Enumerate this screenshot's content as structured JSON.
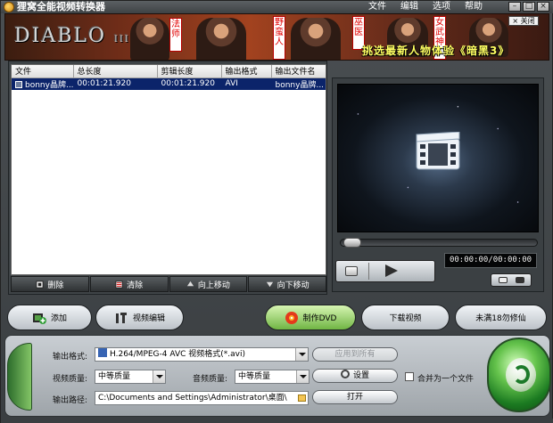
{
  "app": {
    "title": "狸窝全能视频转换器",
    "menu": [
      "文件",
      "编辑",
      "选项",
      "帮助"
    ]
  },
  "banner": {
    "logo": "DIABLO",
    "logo_mark": "III",
    "tags": [
      "法师",
      "野蛮人",
      "巫医",
      "女武神"
    ],
    "promo": "挑选最新人物体验《暗黑3》",
    "close": "关闭"
  },
  "file_list": {
    "columns": [
      "文件",
      "总长度",
      "剪辑长度",
      "输出格式",
      "输出文件名"
    ],
    "rows": [
      {
        "name": "bonny晶牌...",
        "total": "00:01:21.920",
        "clip": "00:01:21.920",
        "format": "AVI",
        "output": "bonny晶牌..."
      }
    ]
  },
  "list_actions": [
    "删除",
    "清除",
    "向上移动",
    "向下移动"
  ],
  "preview": {
    "time": "00:00:00/00:00:00"
  },
  "main_buttons": {
    "add": "添加",
    "edit": "视频编辑",
    "dvd": "制作DVD",
    "download": "下载视频",
    "promo": "未满18勿修仙"
  },
  "output": {
    "format_label": "输出格式:",
    "format_value": "H.264/MPEG-4 AVC 视频格式(*.avi)",
    "apply_all": "应用到所有",
    "video_quality_label": "视频质量:",
    "video_quality_value": "中等质量",
    "audio_quality_label": "音频质量:",
    "audio_quality_value": "中等质量",
    "settings": "设置",
    "merge_label": "合并为一个文件",
    "path_label": "输出路径:",
    "path_value": "C:\\Documents and Settings\\Administrator\\桌面\\",
    "open": "打开"
  }
}
